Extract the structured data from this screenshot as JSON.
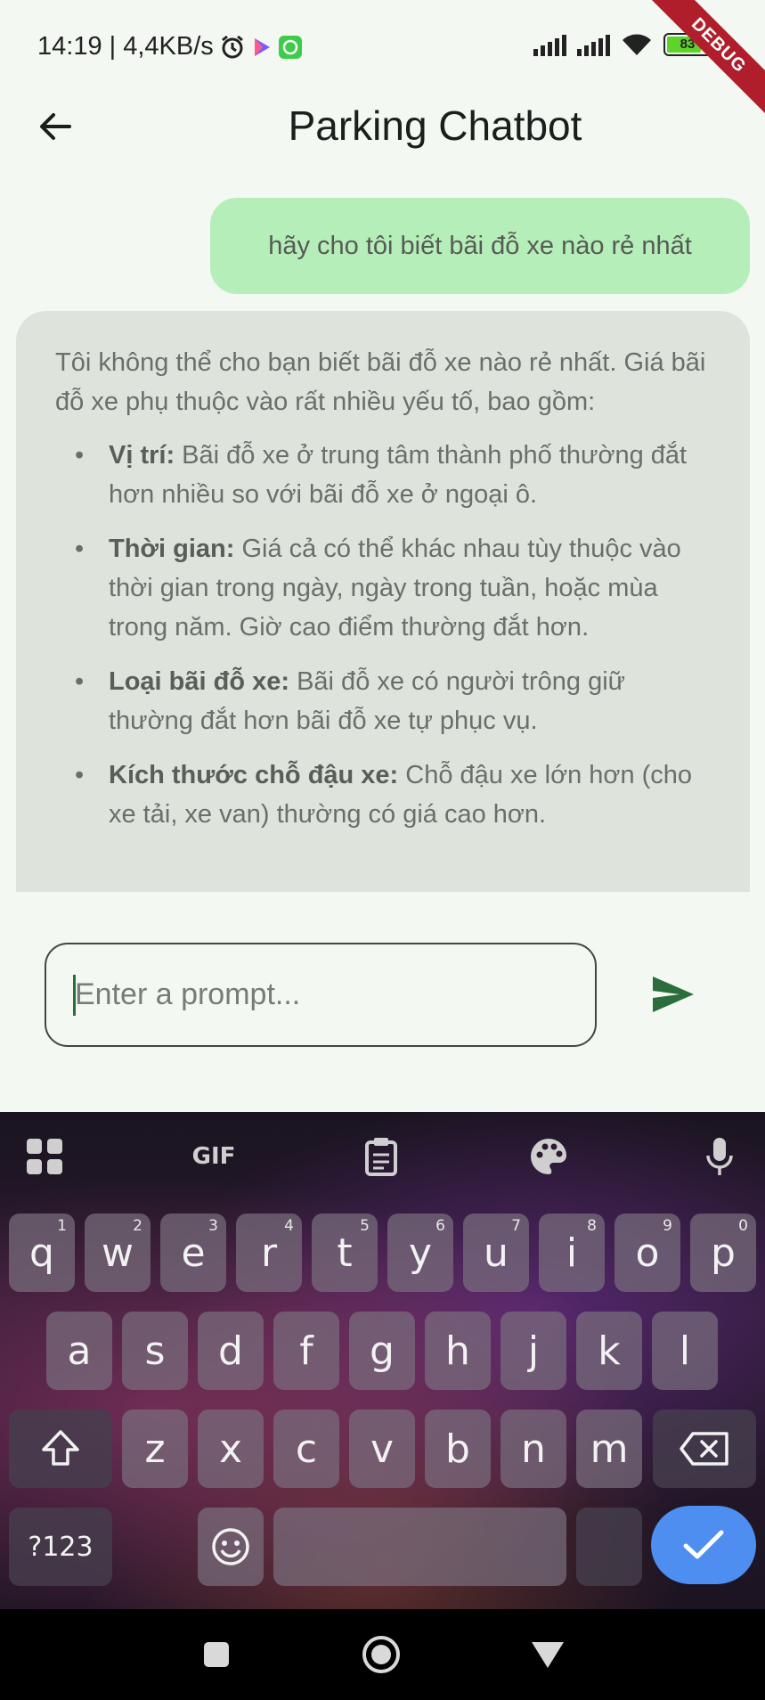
{
  "status_bar": {
    "time_speed": "14:19 | 4,4KB/s",
    "battery_level": "83",
    "icons": [
      "alarm-icon",
      "play-icon",
      "app-notification-icon",
      "signal-icon",
      "signal-icon",
      "wifi-icon",
      "battery-icon"
    ]
  },
  "debug_banner": "DEBUG",
  "app_bar": {
    "title": "Parking Chatbot",
    "back_icon": "arrow-left-icon"
  },
  "chat": {
    "user_message": "hãy cho tôi biết bãi đỗ xe nào rẻ nhất",
    "bot_intro": "Tôi không thể cho bạn biết bãi đỗ xe nào rẻ nhất. Giá bãi đỗ xe phụ thuộc vào rất nhiều yếu tố, bao gồm:",
    "bot_bullets": [
      {
        "bold": "Vị trí:",
        "text": " Bãi đỗ xe ở trung tâm thành phố thường đắt hơn nhiều so với bãi đỗ xe ở ngoại ô."
      },
      {
        "bold": "Thời gian:",
        "text": " Giá cả có thể khác nhau tùy thuộc vào thời gian trong ngày, ngày trong tuần, hoặc mùa trong năm.  Giờ cao điểm thường đắt hơn."
      },
      {
        "bold": "Loại bãi đỗ xe:",
        "text": " Bãi đỗ xe có người trông giữ thường đắt hơn bãi đỗ xe tự phục vụ."
      },
      {
        "bold": "Kích thước chỗ đậu xe:",
        "text": " Chỗ đậu xe lớn hơn (cho xe tải, xe van) thường có giá cao hơn."
      }
    ],
    "bullet_symbol": "•"
  },
  "input": {
    "placeholder": "Enter a prompt...",
    "value": ""
  },
  "keyboard": {
    "toolbar": [
      "apps-grid-icon",
      "gif-icon",
      "clipboard-icon",
      "palette-icon",
      "microphone-icon"
    ],
    "gif_label": "GIF",
    "row1": [
      {
        "k": "q",
        "h": "1"
      },
      {
        "k": "w",
        "h": "2"
      },
      {
        "k": "e",
        "h": "3"
      },
      {
        "k": "r",
        "h": "4"
      },
      {
        "k": "t",
        "h": "5"
      },
      {
        "k": "y",
        "h": "6"
      },
      {
        "k": "u",
        "h": "7"
      },
      {
        "k": "i",
        "h": "8"
      },
      {
        "k": "o",
        "h": "9"
      },
      {
        "k": "p",
        "h": "0"
      }
    ],
    "row2": [
      "a",
      "s",
      "d",
      "f",
      "g",
      "h",
      "j",
      "k",
      "l"
    ],
    "row3": [
      "z",
      "x",
      "c",
      "v",
      "b",
      "n",
      "m"
    ],
    "symbols_key": "?123",
    "accent_color": "#4d8ef0"
  },
  "nav_bar": [
    "recents-square-icon",
    "home-circle-icon",
    "back-triangle-icon"
  ]
}
